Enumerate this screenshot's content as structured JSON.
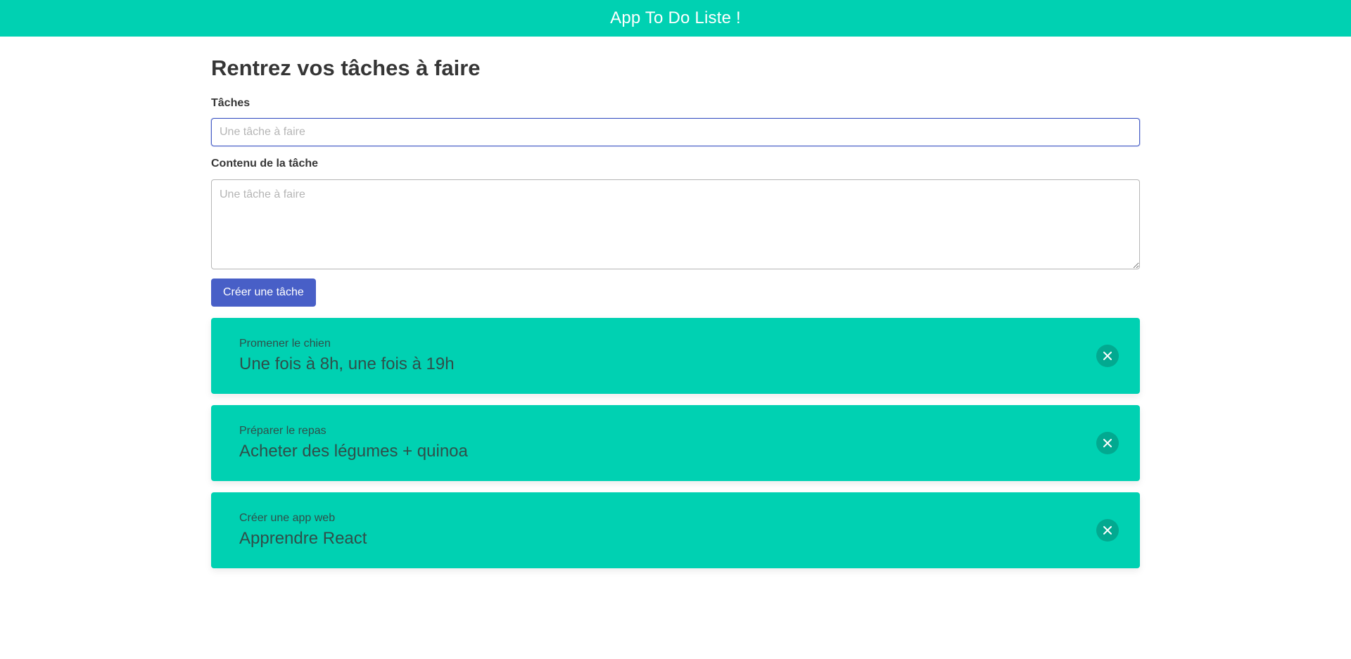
{
  "header": {
    "title": "App To Do Liste !"
  },
  "form": {
    "heading": "Rentrez vos tâches à faire",
    "task_label": "Tâches",
    "task_placeholder": "Une tâche à faire",
    "task_value": "",
    "content_label": "Contenu de la tâche",
    "content_placeholder": "Une tâche à faire",
    "content_value": "",
    "submit_label": "Créer une tâche"
  },
  "tasks": [
    {
      "title": "Promener le chien",
      "content": "Une fois à 8h, une fois à 19h",
      "delete_icon": "close-icon"
    },
    {
      "title": "Préparer le repas",
      "content": "Acheter des légumes + quinoa",
      "delete_icon": "close-icon"
    },
    {
      "title": "Créer une app web",
      "content": "Apprendre React",
      "delete_icon": "close-icon"
    }
  ],
  "colors": {
    "primary": "#00d1b2",
    "button": "#485fc7",
    "input_focus_border": "#485fc7",
    "card_text": "#2f4f4a"
  }
}
